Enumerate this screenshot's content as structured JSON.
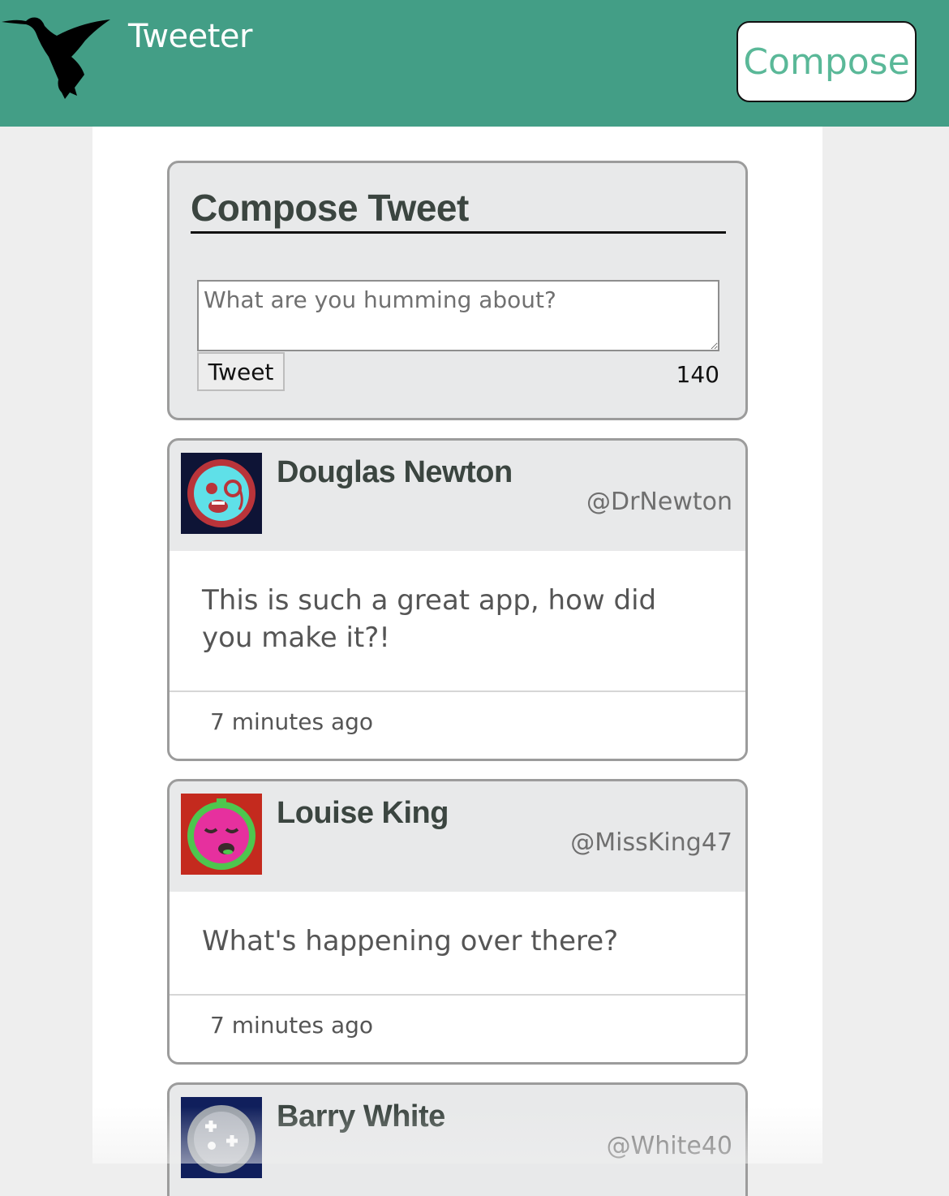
{
  "header": {
    "brand": "Tweeter",
    "compose_label": "Compose",
    "logo_icon": "hummingbird-icon",
    "colors": {
      "bar": "#439e86",
      "compose_text": "#5ab898"
    }
  },
  "compose": {
    "title": "Compose Tweet",
    "placeholder": "What are you humming about?",
    "value": "",
    "button_label": "Tweet",
    "counter": "140"
  },
  "tweets": [
    {
      "name": "Douglas Newton",
      "handle": "@DrNewton",
      "text": "This is such a great app, how did you make it?!",
      "time": "7 minutes ago",
      "avatar": {
        "icon": "monocle-face-icon",
        "bg": "#0e1436",
        "ring": "#b9343a",
        "face": "#5fe0e8"
      }
    },
    {
      "name": "Louise King",
      "handle": "@MissKing47",
      "text": "What's happening over there?",
      "time": "7 minutes ago",
      "avatar": {
        "icon": "sleepy-face-icon",
        "bg": "#c42a1e",
        "ring": "#4ec64e",
        "face": "#e6309e"
      }
    },
    {
      "name": "Barry White",
      "handle": "@White40",
      "avatar": {
        "icon": "gamepad-face-icon",
        "bg": "#101f5c",
        "ring": "#9aa0a8",
        "face": "#b8bcc4"
      }
    }
  ]
}
